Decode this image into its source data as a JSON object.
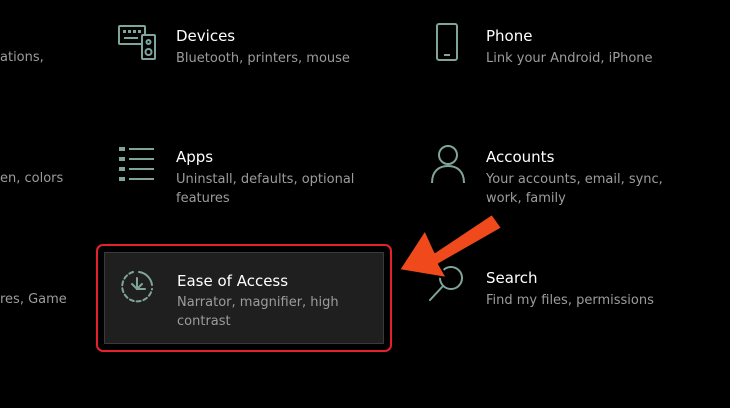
{
  "left_partial": {
    "row1": "ations,",
    "row2": "en, colors",
    "row3": "res, Game"
  },
  "tiles": {
    "devices": {
      "title": "Devices",
      "desc": "Bluetooth, printers, mouse",
      "icon": "keyboard-speaker-icon"
    },
    "phone": {
      "title": "Phone",
      "desc": "Link your Android, iPhone",
      "icon": "phone-icon"
    },
    "apps": {
      "title": "Apps",
      "desc": "Uninstall, defaults, optional features",
      "icon": "apps-list-icon"
    },
    "accounts": {
      "title": "Accounts",
      "desc": "Your accounts, email, sync, work, family",
      "icon": "person-icon"
    },
    "ease": {
      "title": "Ease of Access",
      "desc": "Narrator, magnifier, high contrast",
      "icon": "ease-of-access-icon"
    },
    "search": {
      "title": "Search",
      "desc": "Find my files, permissions",
      "icon": "search-icon"
    }
  },
  "colors": {
    "accent_icon": "#7fa59b",
    "highlight_border": "#e3222b",
    "arrow": "#f04a1c",
    "text_secondary": "#9c9c9c"
  }
}
